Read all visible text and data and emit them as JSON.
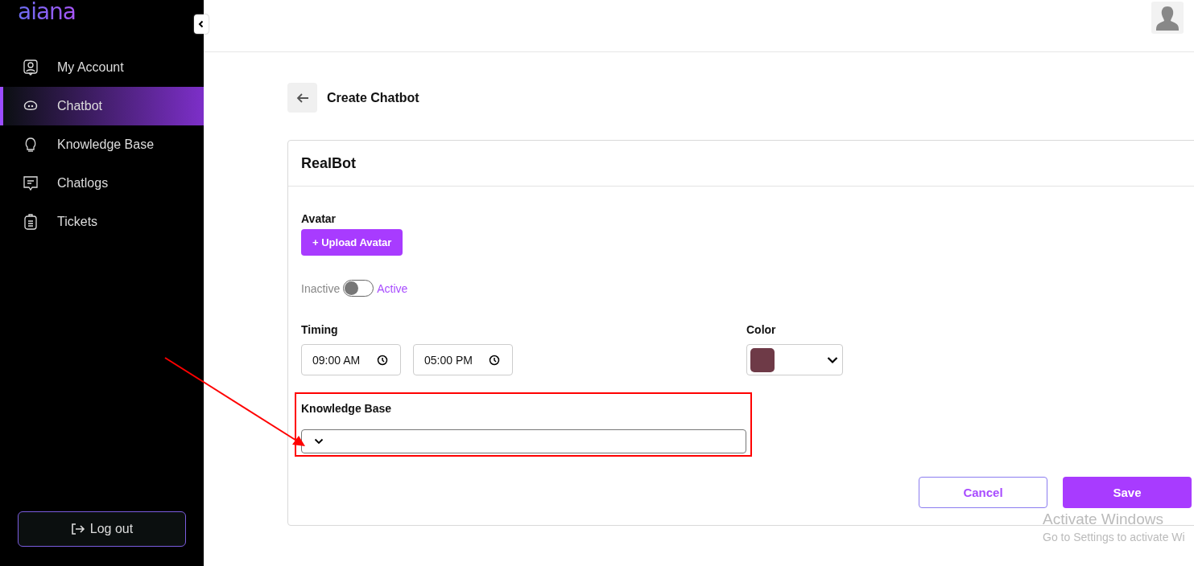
{
  "sidebar": {
    "logo": "aiana",
    "items": [
      {
        "label": "My Account",
        "selected": false
      },
      {
        "label": "Chatbot",
        "selected": true
      },
      {
        "label": "Knowledge Base",
        "selected": false
      },
      {
        "label": "Chatlogs",
        "selected": false
      },
      {
        "label": "Tickets",
        "selected": false
      }
    ],
    "logout": "Log out"
  },
  "page": {
    "title": "Create Chatbot"
  },
  "card": {
    "title": "RealBot",
    "avatar_label": "Avatar",
    "upload_button": "+ Upload Avatar",
    "status": {
      "off_label": "Inactive",
      "on_label": "Active",
      "on": false
    },
    "timing_label": "Timing",
    "start_time": "09:00 AM",
    "end_time": "05:00 PM",
    "color_label": "Color",
    "color": "#6e3a47",
    "knowledge_base_label": "Knowledge Base",
    "buttons": [
      "Cancel",
      "Save"
    ]
  },
  "windows_activation": {
    "title": "Activate Windows",
    "subtitle": "Go to Settings to activate Wi"
  }
}
